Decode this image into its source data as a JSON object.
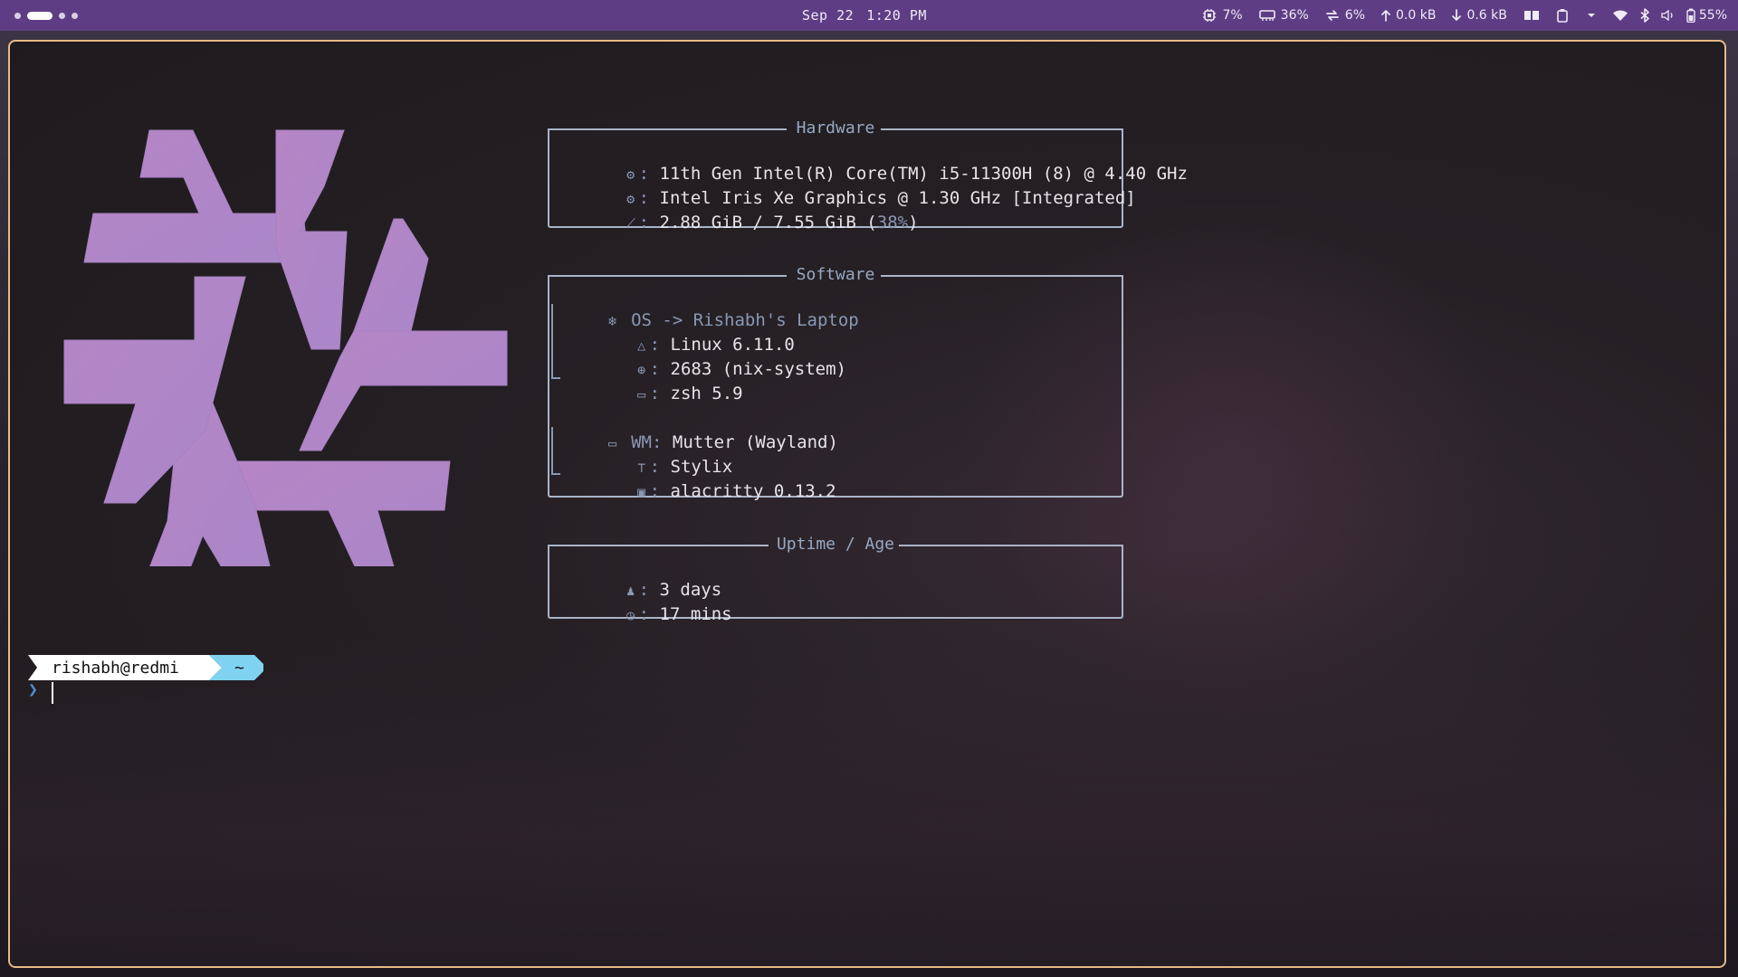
{
  "topbar": {
    "date": "Sep 22",
    "time": "1:20 PM",
    "cpu": "7%",
    "memory": "36%",
    "swap": "6%",
    "net_up": "0.0 kB",
    "net_down": "0.6 kB",
    "battery": "55%"
  },
  "fastfetch": {
    "hardware": {
      "title": "Hardware",
      "cpu": "11th Gen Intel(R) Core(TM) i5-11300H (8) @ 4.40 GHz",
      "gpu": "Intel Iris Xe Graphics @ 1.30 GHz [Integrated]",
      "memory": "2.88 GiB / 7.55 GiB (",
      "memory_pct": "38%",
      "memory_close": ")"
    },
    "software": {
      "title": "Software",
      "os_label": "OS -> Rishabh's Laptop",
      "kernel": "Linux 6.11.0",
      "packages": "2683 (nix-system)",
      "shell": "zsh 5.9",
      "wm_label": "WM",
      "wm": "Mutter (Wayland)",
      "theme": "Stylix",
      "terminal": "alacritty 0.13.2"
    },
    "uptime": {
      "title": "Uptime / Age",
      "days": "3 days",
      "mins": "17 mins"
    }
  },
  "prompt": {
    "user_host": "rishabh@redmi",
    "dir": "~",
    "symbol": "❯"
  },
  "colors": {
    "topbar": "#5f3d85",
    "border": "#e8b987",
    "logo": "#b27fc0",
    "box_line": "#a9b4c8",
    "prompt_dir": "#7fd3f0"
  }
}
